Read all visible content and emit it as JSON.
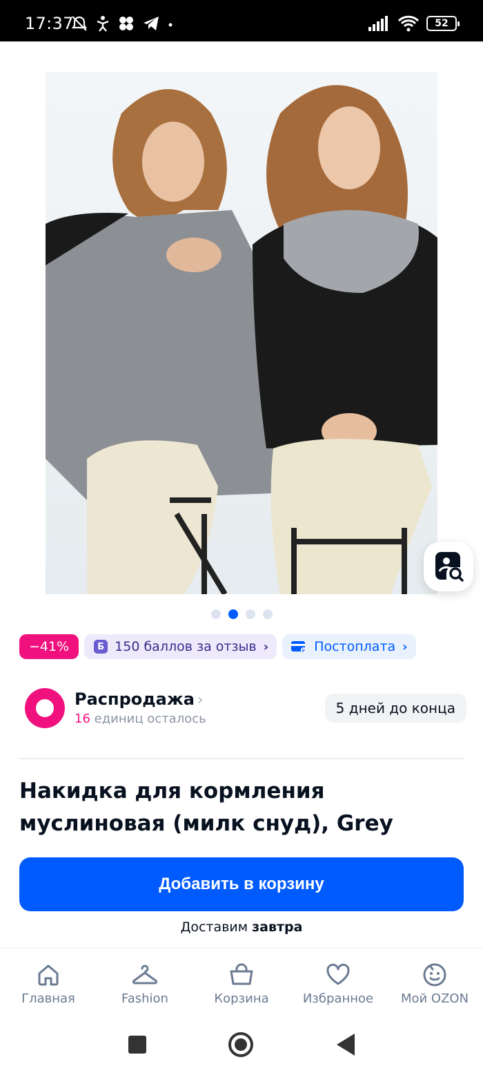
{
  "status_bar": {
    "time": "17:37",
    "battery": "52",
    "left_icons": [
      "mute-icon",
      "accessibility-icon",
      "flower-icon",
      "telegram-icon",
      "dot-icon"
    ],
    "right_icons": [
      "signal-icon",
      "wifi-icon",
      "battery-icon"
    ]
  },
  "gallery": {
    "image": "woman-wearing-nursing-cover-two-ways",
    "dots_total": 4,
    "active_dot": 1
  },
  "badges": {
    "discount": "−41%",
    "points_icon": "Б",
    "points": "150 баллов за отзыв",
    "postpay": "Постоплата"
  },
  "sale": {
    "title": "Распродажа",
    "count": "16",
    "remaining_text": " единиц осталось",
    "deadline": "5 дней до конца"
  },
  "product": {
    "title": "Накидка для кормления муслиновая (милк снуд), Grey"
  },
  "cart": {
    "button_label": "Добавить в корзину",
    "delivery_prefix": "Доставим ",
    "delivery_when": "завтра"
  },
  "nav": {
    "items": [
      {
        "label": "Главная",
        "icon": "home-icon"
      },
      {
        "label": "Fashion",
        "icon": "hanger-icon"
      },
      {
        "label": "Корзина",
        "icon": "basket-icon"
      },
      {
        "label": "Избранное",
        "icon": "heart-icon"
      },
      {
        "label": "Мой OZON",
        "icon": "smiley-icon"
      }
    ]
  },
  "colors": {
    "brand_blue": "#005bff",
    "accent_pink": "#f1117e"
  }
}
